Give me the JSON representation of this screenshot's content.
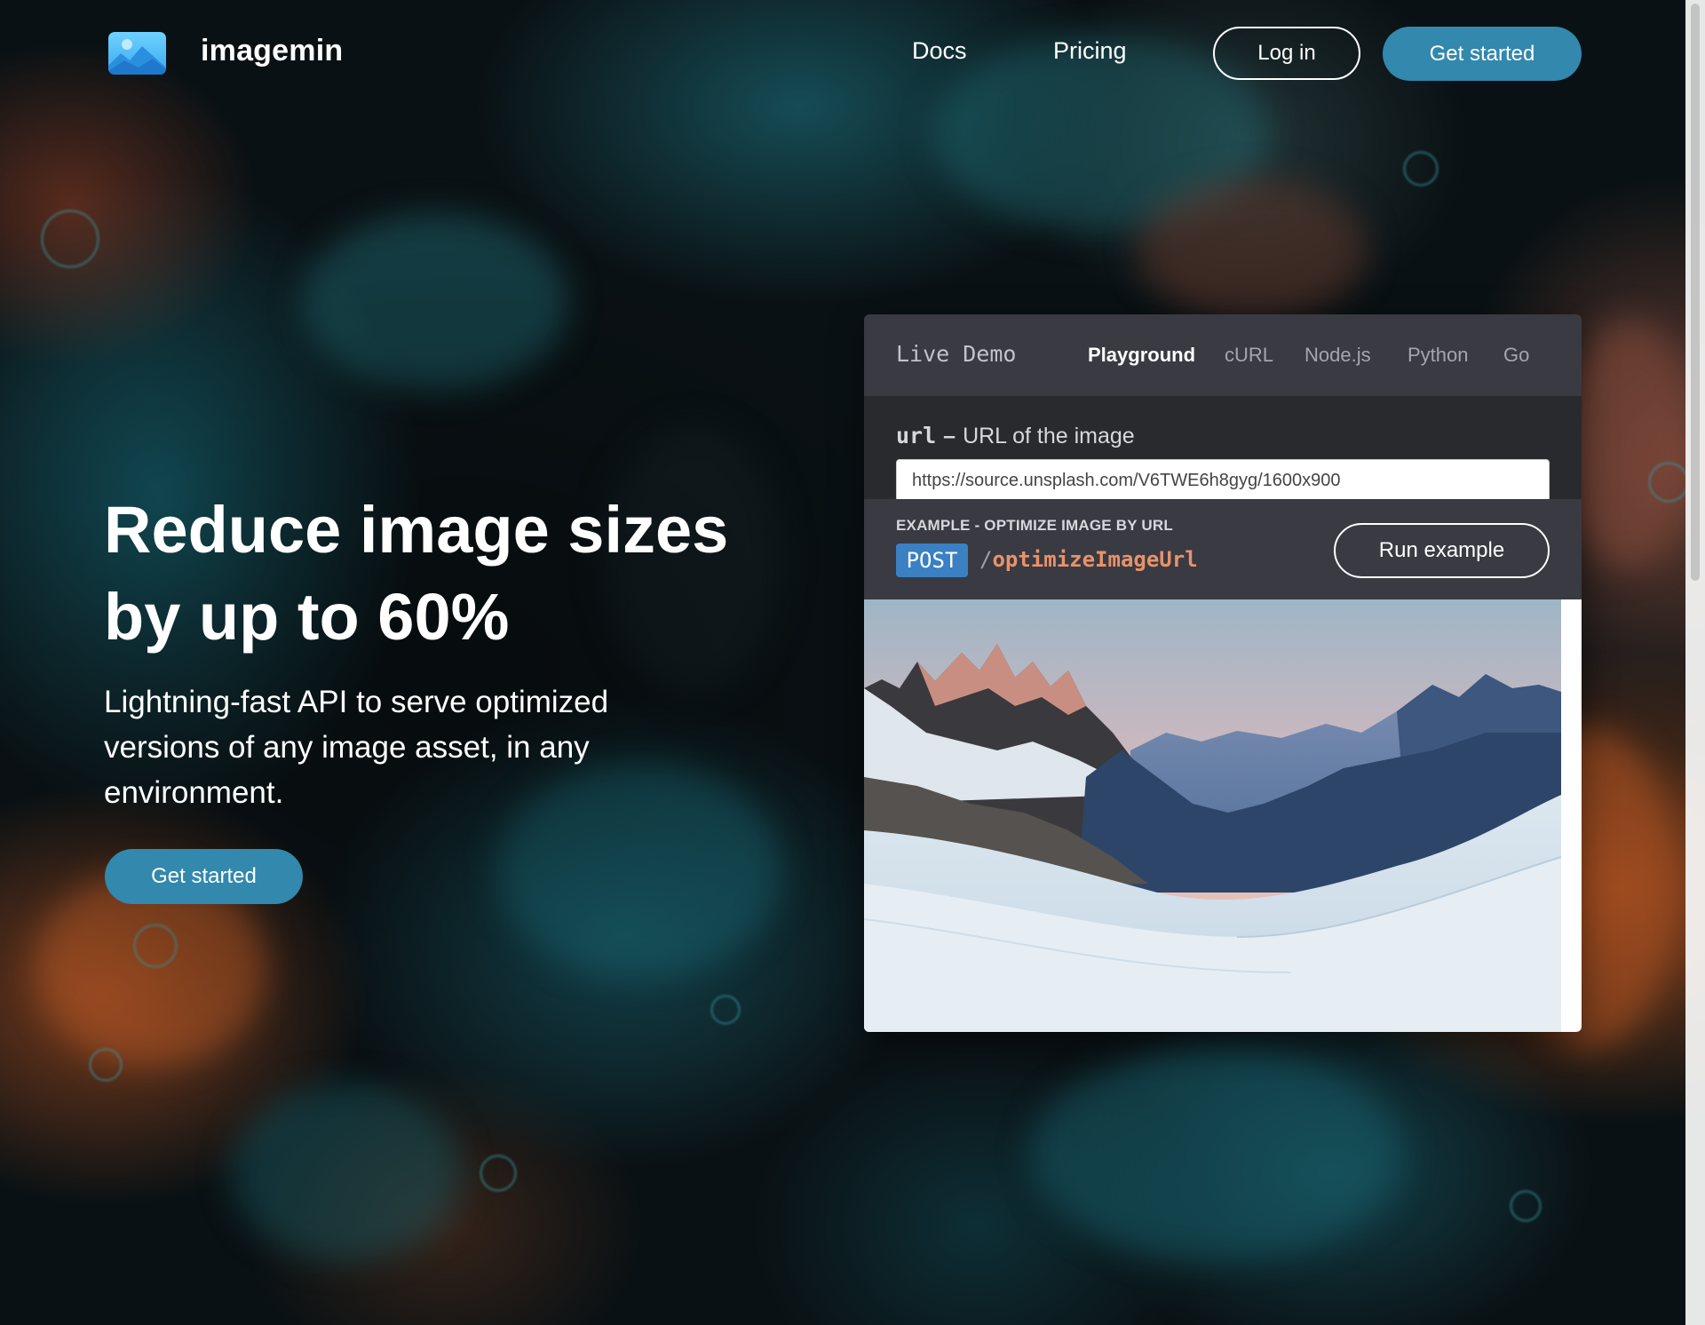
{
  "brand": {
    "name": "imagemin",
    "logo_icon": "image-icon",
    "accent_color": "#3288ad"
  },
  "nav": {
    "docs": "Docs",
    "pricing": "Pricing",
    "login": "Log in",
    "get_started": "Get started"
  },
  "hero": {
    "title_line1": "Reduce image sizes",
    "title_line2": "by up to 60%",
    "subtitle": "Lightning-fast API to serve optimized versions of any image asset, in any environment.",
    "cta": "Get started"
  },
  "demo": {
    "label": "Live Demo",
    "tabs": [
      {
        "label": "Playground",
        "active": true
      },
      {
        "label": "cURL",
        "active": false
      },
      {
        "label": "Node.js",
        "active": false
      },
      {
        "label": "Python",
        "active": false
      },
      {
        "label": "Go",
        "active": false
      }
    ],
    "param": {
      "name": "url",
      "separator": "–",
      "description": "URL of the image",
      "value": "https://source.unsplash.com/V6TWE6h8gyg/1600x900"
    },
    "example": {
      "title": "EXAMPLE - OPTIMIZE IMAGE BY URL",
      "method": "POST",
      "slash": "/",
      "endpoint": "optimizeImageUrl",
      "method_color": "#3a80c3",
      "endpoint_color": "#e8926a",
      "run_label": "Run example"
    },
    "result_image": "mountain-landscape-image"
  }
}
